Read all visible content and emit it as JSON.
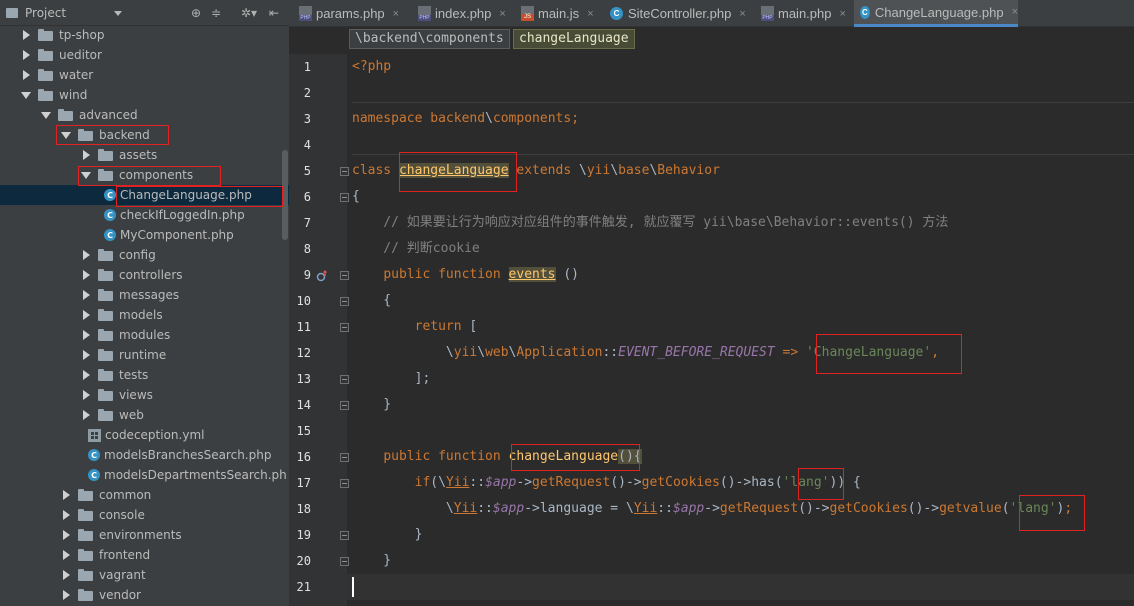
{
  "project_panel": {
    "title": "Project",
    "tree": [
      {
        "label": "tp-shop",
        "type": "folder",
        "expanded": false
      },
      {
        "label": "ueditor",
        "type": "folder",
        "expanded": false
      },
      {
        "label": "water",
        "type": "folder",
        "expanded": false
      },
      {
        "label": "wind",
        "type": "folder",
        "expanded": true
      },
      {
        "label": "advanced",
        "type": "folder",
        "expanded": true
      },
      {
        "label": "backend",
        "type": "folder",
        "expanded": true
      },
      {
        "label": "assets",
        "type": "folder",
        "expanded": false
      },
      {
        "label": "components",
        "type": "folder",
        "expanded": true
      },
      {
        "label": "ChangeLanguage.php",
        "type": "class",
        "selected": true
      },
      {
        "label": "checkIfLoggedIn.php",
        "type": "class"
      },
      {
        "label": "MyComponent.php",
        "type": "class"
      },
      {
        "label": "config",
        "type": "folder",
        "expanded": false
      },
      {
        "label": "controllers",
        "type": "folder",
        "expanded": false
      },
      {
        "label": "messages",
        "type": "folder",
        "expanded": false
      },
      {
        "label": "models",
        "type": "folder",
        "expanded": false
      },
      {
        "label": "modules",
        "type": "folder",
        "expanded": false
      },
      {
        "label": "runtime",
        "type": "folder",
        "expanded": false
      },
      {
        "label": "tests",
        "type": "folder",
        "expanded": false
      },
      {
        "label": "views",
        "type": "folder",
        "expanded": false
      },
      {
        "label": "web",
        "type": "folder",
        "expanded": false
      },
      {
        "label": "codeception.yml",
        "type": "yml"
      },
      {
        "label": "modelsBranchesSearch.php",
        "type": "class"
      },
      {
        "label": "modelsDepartmentsSearch.ph",
        "type": "class"
      },
      {
        "label": "common",
        "type": "folder",
        "expanded": false
      },
      {
        "label": "console",
        "type": "folder",
        "expanded": false
      },
      {
        "label": "environments",
        "type": "folder",
        "expanded": false
      },
      {
        "label": "frontend",
        "type": "folder",
        "expanded": false
      },
      {
        "label": "vagrant",
        "type": "folder",
        "expanded": false
      },
      {
        "label": "vendor",
        "type": "folder",
        "expanded": false
      }
    ]
  },
  "tabs": [
    {
      "label": "params.php",
      "icon": "php-file-icon",
      "active": false
    },
    {
      "label": "index.php",
      "icon": "php-file-icon",
      "active": false
    },
    {
      "label": "main.js",
      "icon": "js-file-icon",
      "active": false
    },
    {
      "label": "SiteController.php",
      "icon": "class-icon",
      "active": false
    },
    {
      "label": "main.php",
      "icon": "php-file-icon",
      "active": false
    },
    {
      "label": "ChangeLanguage.php",
      "icon": "class-icon",
      "active": true
    }
  ],
  "breadcrumb": [
    "\\backend\\components",
    "changeLanguage"
  ],
  "line_numbers": [
    "1",
    "2",
    "3",
    "4",
    "5",
    "6",
    "7",
    "8",
    "9",
    "10",
    "11",
    "12",
    "13",
    "14",
    "15",
    "16",
    "17",
    "18",
    "19",
    "20",
    "21"
  ],
  "code": {
    "l1": "<?php",
    "l3_kw": "namespace",
    "l3_ns1": "backend",
    "l3_ns2": "components",
    "l5_kw": "class",
    "l5_name": "changeLanguage",
    "l5_ext": "extends",
    "l5_bs1": "\\",
    "l5_p1": "yii",
    "l5_p2": "base",
    "l5_p3": "Behavior",
    "l6": "{",
    "l7": "    // 如果要让行为响应对应组件的事件触发, 就应覆写 yii\\base\\Behavior::events() 方法",
    "l8": "    // 判断cookie",
    "l9_kw": "public function",
    "l9_fn": "events",
    "l9_rest": " ()",
    "l10": "    {",
    "l11_kw": "return",
    "l11_rest": " [",
    "l12_p1": "yii",
    "l12_p2": "web",
    "l12_p3": "Application",
    "l12_const": "EVENT_BEFORE_REQUEST",
    "l12_arrow": "=>",
    "l12_str": "'ChangeLanguage'",
    "l13": "        ];",
    "l14": "    }",
    "l16_kw": "public function",
    "l16_fn": "changeLanguage",
    "l16_rest": "(){",
    "l17_if": "if",
    "l17_yii": "Yii",
    "l17_app": "$app",
    "l17_m1": "getRequest",
    "l17_m2": "getCookies",
    "l17_m3": "has",
    "l17_str": "'lang'",
    "l18_yii": "Yii",
    "l18_app": "$app",
    "l18_prop": "language",
    "l18_yii2": "Yii",
    "l18_app2": "$app",
    "l18_m1": "getRequest",
    "l18_m2": "getCookies",
    "l18_m3": "getvalue",
    "l18_str": "'lang'",
    "l19": "        }",
    "l20": "    }"
  }
}
